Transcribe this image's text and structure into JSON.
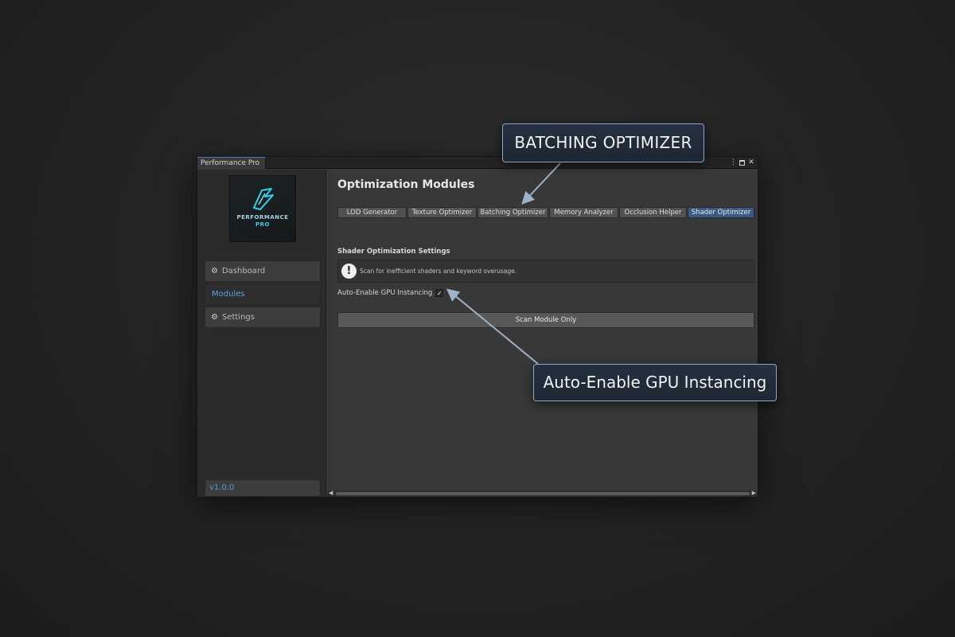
{
  "window": {
    "tab_title": "Performance Pro",
    "menu_icon": "more-vertical-icon",
    "maximize_icon": "maximize-icon",
    "close_glyph": "✕"
  },
  "sidebar": {
    "logo_word": "PERFORMANCE",
    "logo_sub": "PRO",
    "items": [
      {
        "label": "Dashboard",
        "icon": "gear-icon"
      },
      {
        "label": "Modules"
      },
      {
        "label": "Settings",
        "icon": "gear-icon"
      }
    ],
    "version": "v1.0.0"
  },
  "main": {
    "title": "Optimization Modules",
    "tabs": [
      {
        "label": "LOD Generator"
      },
      {
        "label": "Texture Optimizer"
      },
      {
        "label": "Batching Optimizer"
      },
      {
        "label": "Memory Analyzer"
      },
      {
        "label": "Occlusion Helper"
      },
      {
        "label": "Shader Optimizer",
        "selected": true
      }
    ],
    "section_title": "Shader Optimization Settings",
    "info_glyph": "!",
    "info_text": "Scan for inefficient shaders and keyword overusage.",
    "toggle": {
      "label": "Auto-Enable GPU Instancing",
      "checked": true,
      "check_glyph": "✓"
    },
    "scan_button": "Scan Module Only"
  },
  "callouts": {
    "batching": "BATCHING OPTIMIZER",
    "gpu": "Auto-Enable GPU Instancing"
  },
  "colors": {
    "accent": "#4f9ae0",
    "selected_tab": "#3a5a86",
    "callout_border": "#8ea6bf"
  }
}
